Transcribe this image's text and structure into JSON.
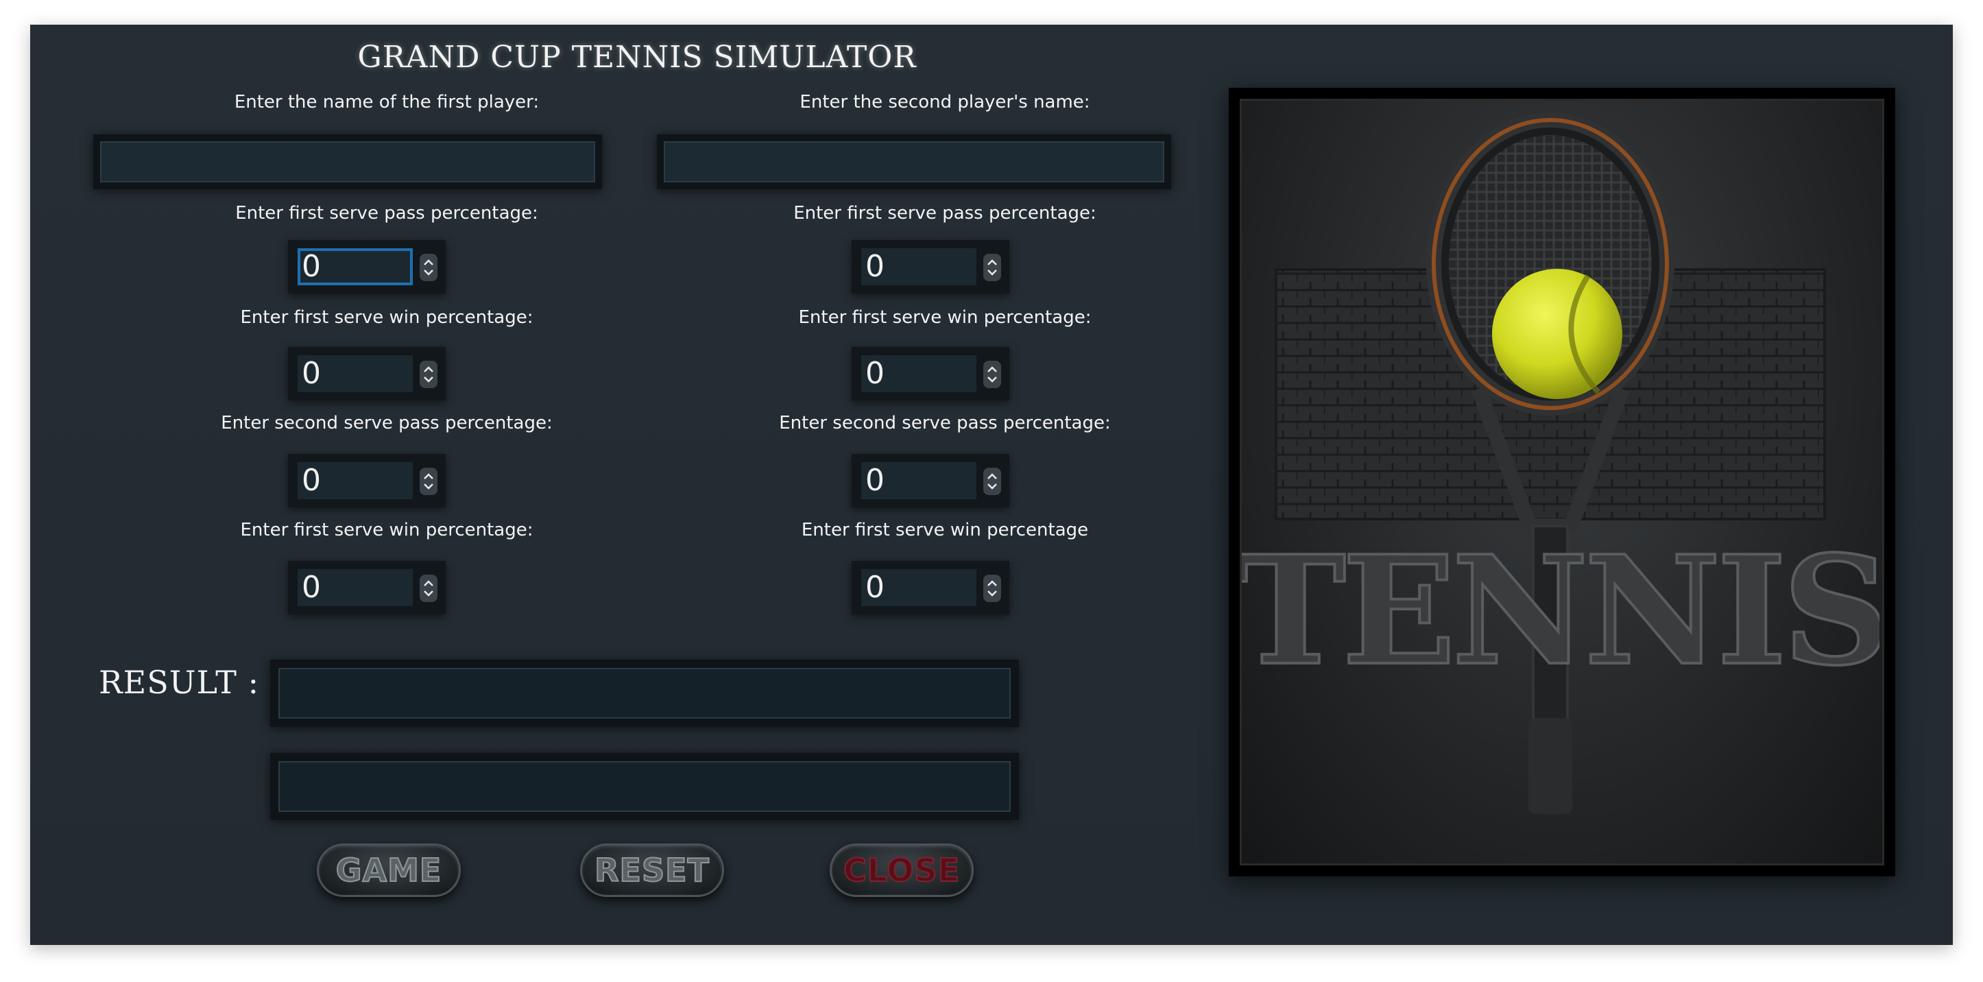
{
  "app": {
    "title": "GRAND CUP TENNIS SIMULATOR"
  },
  "player1": {
    "name_label": "Enter the name of the first player:",
    "name_value": "",
    "first_serve_pass_label": "Enter first serve pass percentage:",
    "first_serve_pass_value": "0",
    "first_serve_win_label": "Enter first serve win percentage:",
    "first_serve_win_value": "0",
    "second_serve_pass_label": "Enter second serve pass percentage:",
    "second_serve_pass_value": "0",
    "second_serve_win_label": "Enter first serve win percentage:",
    "second_serve_win_value": "0"
  },
  "player2": {
    "name_label": "Enter the second player's name:",
    "name_value": "",
    "first_serve_pass_label": "Enter first serve pass percentage:",
    "first_serve_pass_value": "0",
    "first_serve_win_label": "Enter first serve win percentage:",
    "first_serve_win_value": "0",
    "second_serve_pass_label": "Enter second serve pass percentage:",
    "second_serve_pass_value": "0",
    "second_serve_win_label": "Enter first serve win percentage",
    "second_serve_win_value": "0"
  },
  "result": {
    "label": "RESULT :",
    "line1": "",
    "line2": ""
  },
  "buttons": {
    "game": "GAME",
    "reset": "RESET",
    "close": "CLOSE"
  },
  "image": {
    "word": "TENNIS",
    "icons": [
      "tennis-racket-icon",
      "tennis-ball-icon"
    ]
  },
  "colors": {
    "background": "#232c32",
    "field": "#1b2a33",
    "focus": "#1f6fb0",
    "ball": "#d4e021",
    "close_text": "#5a0f18"
  }
}
